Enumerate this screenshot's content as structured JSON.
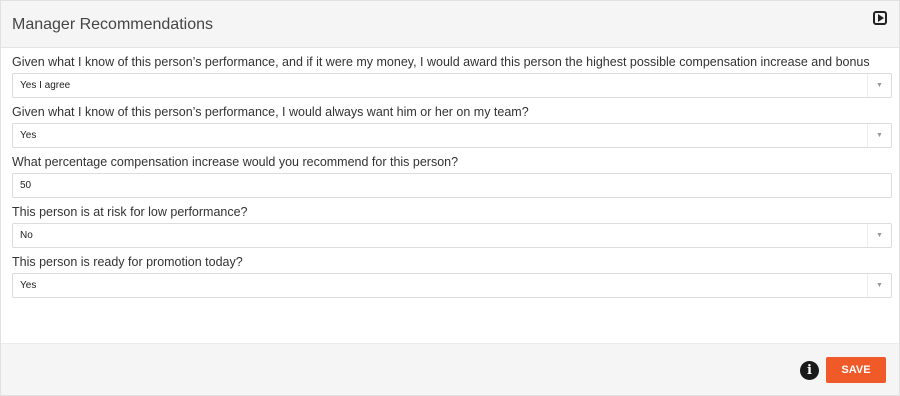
{
  "panel": {
    "title": "Manager Recommendations"
  },
  "questions": [
    {
      "label": "Given what I know of this person’s performance, and if it were my money, I would award this person the highest possible compensation increase and bonus",
      "value": "Yes I agree",
      "type": "select"
    },
    {
      "label": "Given what I know of this person’s performance, I would always want him or her on my team?",
      "value": "Yes",
      "type": "select"
    },
    {
      "label": "What percentage compensation increase would you recommend for this person?",
      "value": "50",
      "type": "text"
    },
    {
      "label": "This person is at risk for low performance?",
      "value": "No",
      "type": "select"
    },
    {
      "label": "This person is ready for promotion today?",
      "value": "Yes",
      "type": "select"
    }
  ],
  "footer": {
    "save_label": "SAVE",
    "info_glyph": "i"
  },
  "icons": {
    "expand": "play-square-icon",
    "info": "info-circle-icon",
    "dropdown": "caret-down-icon"
  },
  "colors": {
    "accent": "#f05a28",
    "header_bg": "#f5f5f5"
  }
}
